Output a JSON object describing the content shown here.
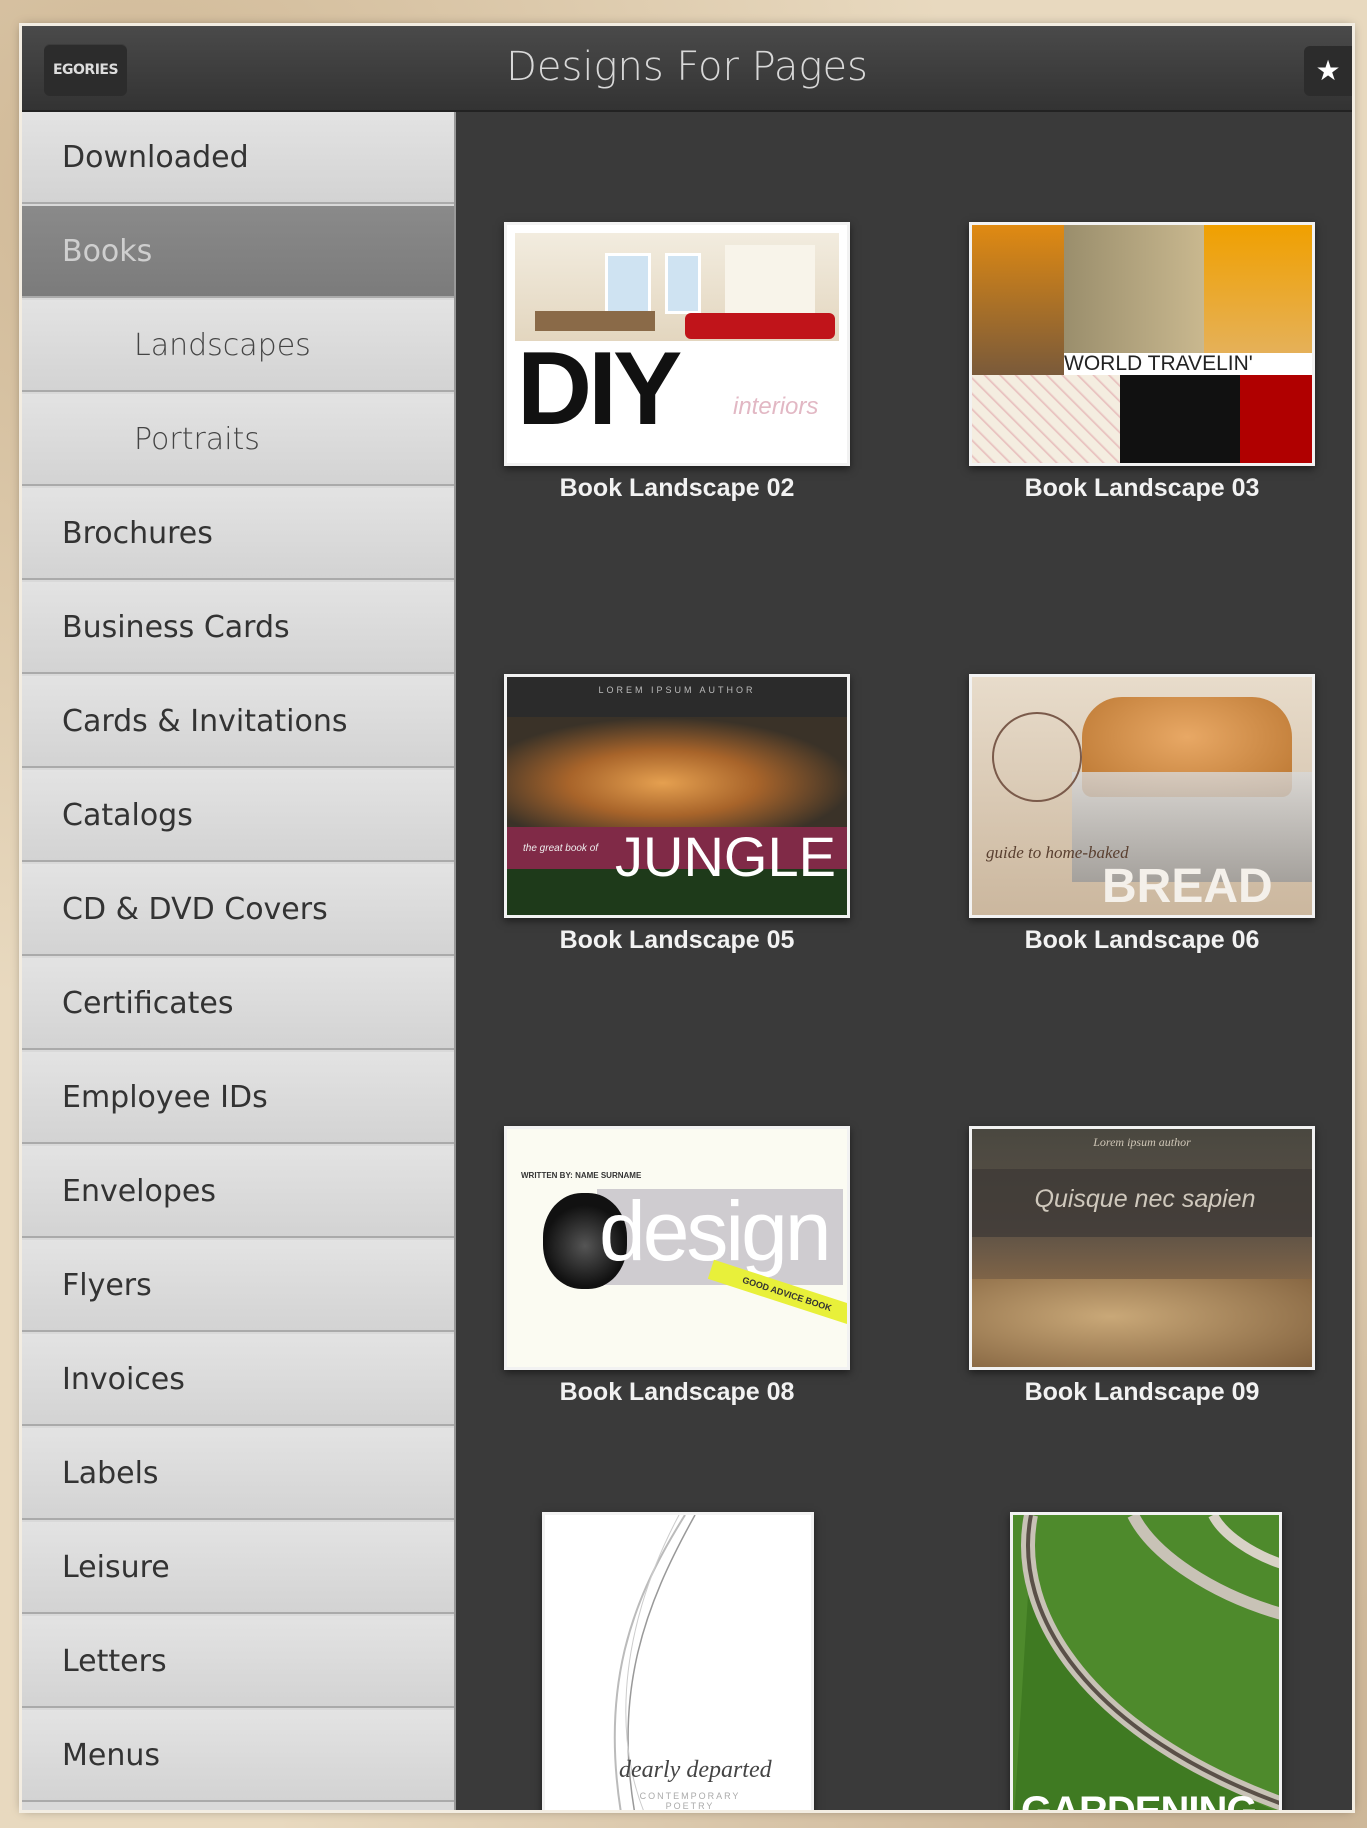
{
  "header": {
    "categories_label": "EGORIES",
    "title": "Designs For Pages",
    "star_icon": "star-icon"
  },
  "sidebar": {
    "items": [
      {
        "label": "Downloaded",
        "level": 0,
        "selected": false
      },
      {
        "label": "Books",
        "level": 0,
        "selected": true
      },
      {
        "label": "Landscapes",
        "level": 1,
        "selected": false
      },
      {
        "label": "Portraits",
        "level": 1,
        "selected": false
      },
      {
        "label": "Brochures",
        "level": 0,
        "selected": false
      },
      {
        "label": "Business Cards",
        "level": 0,
        "selected": false
      },
      {
        "label": "Cards & Invitations",
        "level": 0,
        "selected": false
      },
      {
        "label": "Catalogs",
        "level": 0,
        "selected": false
      },
      {
        "label": "CD & DVD Covers",
        "level": 0,
        "selected": false
      },
      {
        "label": "Certificates",
        "level": 0,
        "selected": false
      },
      {
        "label": "Employee IDs",
        "level": 0,
        "selected": false
      },
      {
        "label": "Envelopes",
        "level": 0,
        "selected": false
      },
      {
        "label": "Flyers",
        "level": 0,
        "selected": false
      },
      {
        "label": "Invoices",
        "level": 0,
        "selected": false
      },
      {
        "label": "Labels",
        "level": 0,
        "selected": false
      },
      {
        "label": "Leisure",
        "level": 0,
        "selected": false
      },
      {
        "label": "Letters",
        "level": 0,
        "selected": false
      },
      {
        "label": "Menus",
        "level": 0,
        "selected": false
      }
    ]
  },
  "templates": [
    {
      "caption": "Book Landscape 02",
      "cover_big": "DIY",
      "cover_small": "interiors"
    },
    {
      "caption": "Book Landscape 03",
      "cover_big": "WORLD TRAVELIN'"
    },
    {
      "caption": "Book Landscape 05",
      "cover_big": "JUNGLE",
      "cover_small": "the great book of",
      "cover_top": "LOREM IPSUM AUTHOR"
    },
    {
      "caption": "Book Landscape 06",
      "cover_big": "BREAD",
      "cover_small": "guide to home-baked"
    },
    {
      "caption": "Book Landscape 08",
      "cover_big": "design",
      "cover_small": "GOOD ADVICE BOOK",
      "cover_top": "WRITTEN BY: NAME SURNAME"
    },
    {
      "caption": "Book Landscape 09",
      "cover_big": "Quisque nec sapien",
      "cover_top": "Lorem ipsum author"
    },
    {
      "caption": "",
      "cover_big": "dearly departed",
      "cover_small": "CONTEMPORARY POETRY"
    },
    {
      "caption": "",
      "cover_big": "GARDENING"
    }
  ],
  "colors": {
    "panel": "#3a3a3a",
    "sidebar": "#d9d9d9",
    "selected": "#7f7f7f",
    "jungle_band": "#8a2a4a",
    "travel_red": "#b00000"
  }
}
